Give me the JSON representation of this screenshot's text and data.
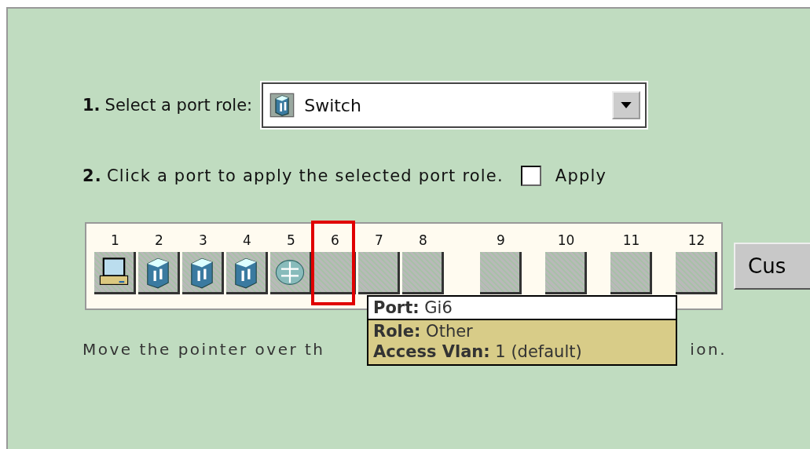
{
  "step1": {
    "number": "1.",
    "label": "Select a port role:",
    "dropdown": {
      "value": "Switch",
      "kind": "switch"
    }
  },
  "step2": {
    "number": "2.",
    "label": "Click a port to apply the selected port role.",
    "apply_all": {
      "label": "Apply",
      "checked": false
    }
  },
  "ports": [
    {
      "label": "1",
      "kind": "pc",
      "selected": false
    },
    {
      "label": "2",
      "kind": "switch",
      "selected": false
    },
    {
      "label": "3",
      "kind": "switch",
      "selected": false
    },
    {
      "label": "4",
      "kind": "switch",
      "selected": false
    },
    {
      "label": "5",
      "kind": "router",
      "selected": false
    },
    {
      "label": "6",
      "kind": "other",
      "selected": true
    },
    {
      "label": "7",
      "kind": "other",
      "selected": false
    },
    {
      "label": "8",
      "kind": "other",
      "selected": false
    },
    {
      "label": "9",
      "kind": "other",
      "selected": false
    },
    {
      "label": "10",
      "kind": "other",
      "selected": false
    },
    {
      "label": "11",
      "kind": "other",
      "selected": false
    },
    {
      "label": "12",
      "kind": "other",
      "selected": false
    }
  ],
  "custom_button": "Cus",
  "hint": {
    "start": "Move the pointer over th",
    "end": "ion."
  },
  "tooltip": {
    "port_label": "Port:",
    "port_value": "Gi6",
    "lines": [
      {
        "label": "Role:",
        "value": "Other"
      },
      {
        "label": "Access Vlan:",
        "value": "1 (default)"
      }
    ]
  }
}
